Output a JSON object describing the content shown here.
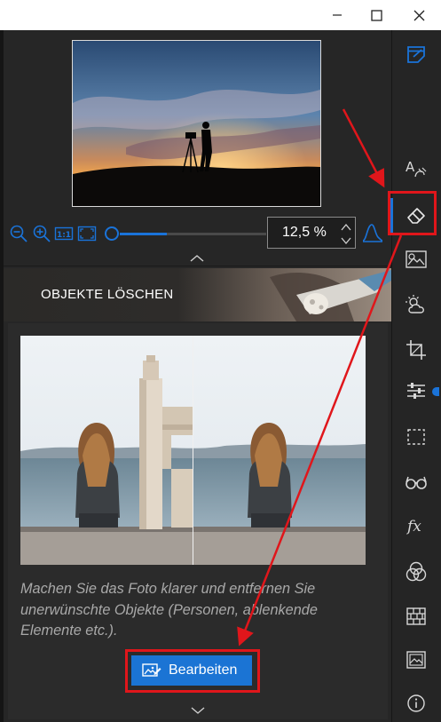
{
  "window": {
    "minimize_icon": "minimize-icon",
    "maximize_icon": "maximize-icon",
    "close_icon": "close-icon"
  },
  "navigator": {
    "zoom_value": "12,5 %",
    "zoom_slider_fraction": 0.32,
    "icons": [
      "zoom-out-icon",
      "zoom-in-icon",
      "actual-size-icon",
      "fit-to-screen-icon",
      "histogram-icon"
    ]
  },
  "panel": {
    "title": "OBJEKTE LÖSCHEN",
    "description": "Machen Sie das Foto klarer und entfernen Sie unerwünschte Objekte (Personen, ablenkende Elemente etc.).",
    "edit_button_label": "Bearbeiten"
  },
  "toolbar": {
    "tools": [
      "notes-icon",
      "text-icon",
      "eraser-icon",
      "heal-icon",
      "weather-icon",
      "crop-icon",
      "adjustments-icon",
      "selection-icon",
      "glasses-icon",
      "fx-icon",
      "color-circles-icon",
      "brick-wall-icon",
      "picture-icon",
      "info-icon"
    ],
    "active_tool": "eraser-icon"
  },
  "colors": {
    "accent": "#1b74d4",
    "annotation": "#e0161b",
    "panel_bg": "#262626",
    "toolbar_bg": "#252525"
  }
}
